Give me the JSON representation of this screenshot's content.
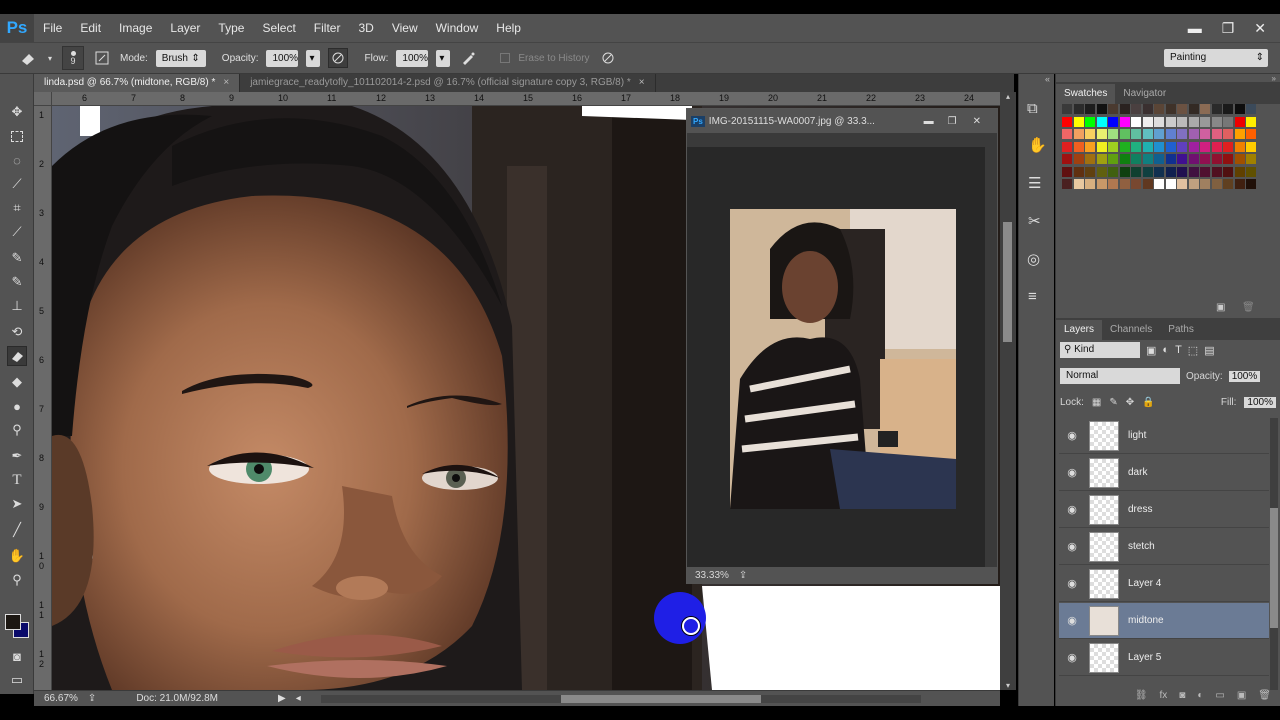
{
  "app": {
    "logo": "Ps"
  },
  "menu": [
    "File",
    "Edit",
    "Image",
    "Layer",
    "Type",
    "Select",
    "Filter",
    "3D",
    "View",
    "Window",
    "Help"
  ],
  "window_controls": {
    "minimize": "▬",
    "restore": "❐",
    "close": "✕"
  },
  "options": {
    "brush_size": "9",
    "mode_label": "Mode:",
    "mode_value": "Brush",
    "opacity_label": "Opacity:",
    "opacity_value": "100%",
    "flow_label": "Flow:",
    "flow_value": "100%",
    "erase_history": "Erase to History",
    "workspace": "Painting"
  },
  "tabs": [
    {
      "label": "linda.psd @ 66.7% (midtone, RGB/8) *",
      "active": true
    },
    {
      "label": "jamiegrace_readytofly_101102014-2.psd @ 16.7% (official signature copy 3, RGB/8) *",
      "active": false
    }
  ],
  "tab_close": "×",
  "ruler_top": [
    "6",
    "7",
    "8",
    "9",
    "10",
    "11",
    "12",
    "13",
    "14",
    "15",
    "16",
    "17",
    "18",
    "19",
    "20",
    "21",
    "22",
    "23",
    "24"
  ],
  "ruler_left": [
    "1",
    "2",
    "3",
    "4",
    "5",
    "6",
    "7",
    "8",
    "9",
    "1 0",
    "1 1",
    "1 2"
  ],
  "doc_window": {
    "title": "IMG-20151115-WA0007.jpg @ 33.3...",
    "zoom": "33.33%"
  },
  "status": {
    "zoom": "66.67%",
    "doc": "Doc: 21.0M/92.8M"
  },
  "swatches_panel": {
    "tabs": [
      "Swatches",
      "Navigator"
    ]
  },
  "swatch_colors": {
    "row0": [
      "#3a3a3a",
      "#2b2b2b",
      "#1d1d1d",
      "#111111",
      "#4a3a30",
      "#2a2220",
      "#4a4040",
      "#3a3030",
      "#5a4536",
      "#3f3229",
      "#6b5242",
      "#332a24",
      "#8b6b54",
      "#2a2a2a",
      "#1a1a1a",
      "#0d0d0d",
      "#3b4a5a"
    ],
    "row1": [
      "#ff0000",
      "#ffff00",
      "#00ff00",
      "#00ffff",
      "#0000ff",
      "#ff00ff",
      "#ffffff",
      "#eeeeee",
      "#dddddd",
      "#cccccc",
      "#bbbbbb",
      "#aaaaaa",
      "#999999",
      "#888888",
      "#777777",
      "#ee0000",
      "#ffee00"
    ],
    "row2": [
      "#ee6666",
      "#f0a060",
      "#f8d060",
      "#e8f070",
      "#a0e080",
      "#60c060",
      "#60c0a0",
      "#60c0c0",
      "#60a0d0",
      "#6080d0",
      "#8070c0",
      "#a060b0",
      "#d060a0",
      "#e06080",
      "#e06060",
      "#ffa000",
      "#ff6000"
    ],
    "row3": [
      "#e02020",
      "#f06020",
      "#f8a020",
      "#f0f020",
      "#a0d020",
      "#20b020",
      "#20b080",
      "#20b0b0",
      "#2090d0",
      "#2060d0",
      "#6040c0",
      "#a020a0",
      "#d02080",
      "#e02050",
      "#e02020",
      "#f08000",
      "#ffcc00"
    ],
    "row4": [
      "#a01010",
      "#a04010",
      "#a07010",
      "#a0a010",
      "#60a010",
      "#108010",
      "#108060",
      "#108080",
      "#106090",
      "#103090",
      "#401090",
      "#701070",
      "#901050",
      "#901030",
      "#901010",
      "#a05000",
      "#a08000"
    ],
    "row5": [
      "#601010",
      "#603010",
      "#604010",
      "#606010",
      "#406010",
      "#104010",
      "#104030",
      "#104040",
      "#103050",
      "#102050",
      "#201050",
      "#401040",
      "#501030",
      "#501020",
      "#501010",
      "#604000",
      "#605000"
    ],
    "row6": [
      "#4a2020",
      "#e8c8a0",
      "#d8b080",
      "#c89868",
      "#b07850",
      "#906040",
      "#784830",
      "#603820",
      "#ffffff",
      "#ffffff",
      "#e0c0a0",
      "#c0a080",
      "#a08060",
      "#806040",
      "#604020",
      "#402010",
      "#201008"
    ]
  },
  "layers_panel": {
    "tabs": [
      "Layers",
      "Channels",
      "Paths"
    ],
    "kind": "Kind",
    "blend": "Normal",
    "opacity_label": "Opacity:",
    "opacity_value": "100%",
    "lock_label": "Lock:",
    "fill_label": "Fill:",
    "fill_value": "100%",
    "layers": [
      {
        "name": "light",
        "selected": false
      },
      {
        "name": "dark",
        "selected": false
      },
      {
        "name": "dress",
        "selected": false
      },
      {
        "name": "stetch",
        "selected": false
      },
      {
        "name": "Layer 4",
        "selected": false
      },
      {
        "name": "midtone",
        "selected": true
      },
      {
        "name": "Layer 5",
        "selected": false
      }
    ]
  }
}
